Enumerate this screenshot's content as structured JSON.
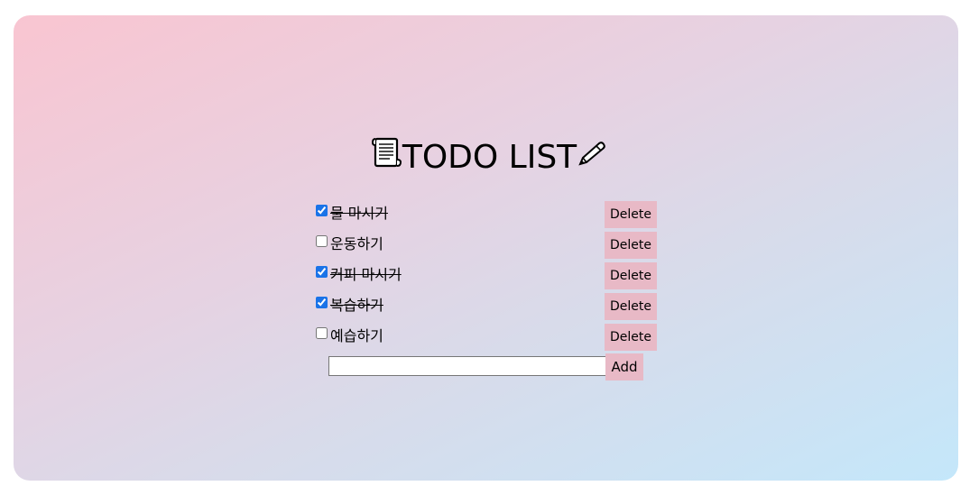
{
  "header": {
    "title": "TODO LIST",
    "leading_icon": "scroll-icon",
    "trailing_icon": "pen-icon"
  },
  "todos": [
    {
      "text": "물 마시기",
      "checked": true,
      "delete_label": "Delete"
    },
    {
      "text": "운동하기",
      "checked": false,
      "delete_label": "Delete"
    },
    {
      "text": "커피 마시기",
      "checked": true,
      "delete_label": "Delete"
    },
    {
      "text": "복습하기",
      "checked": true,
      "delete_label": "Delete"
    },
    {
      "text": "예습하기",
      "checked": false,
      "delete_label": "Delete"
    }
  ],
  "add_form": {
    "input_value": "",
    "placeholder": "",
    "button_label": "Add"
  },
  "colors": {
    "button_background": "#e8b9c6",
    "gradient_start": "#f9c5d1",
    "gradient_end": "#c4e7fa"
  }
}
